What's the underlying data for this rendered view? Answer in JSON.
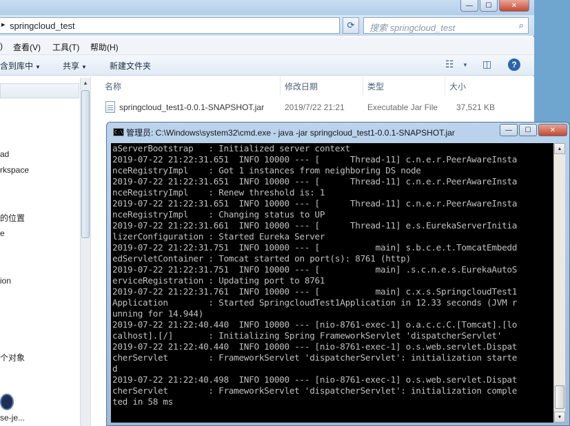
{
  "explorer": {
    "address": "springcloud_test",
    "search_placeholder": "搜索 springcloud_test",
    "menu": [
      "查看(V)",
      "工具(T)",
      "帮助(H)"
    ],
    "menu_partial": ")",
    "toolbar": {
      "include_library": "含到库中",
      "share": "共享",
      "new_folder": "新建文件夹"
    },
    "nav_items": [
      "ad",
      "rkspace",
      "的位置",
      "e",
      "ion",
      "个对象"
    ],
    "taskbar_label": "se-je...",
    "columns": {
      "name": "名称",
      "modified": "修改日期",
      "type": "类型",
      "size": "大小"
    },
    "files": [
      {
        "name": "springcloud_test1-0.0.1-SNAPSHOT.jar",
        "modified": "2019/7/22 21:21",
        "type": "Executable Jar File",
        "size": "37,521 KB"
      }
    ]
  },
  "cmd": {
    "title": "管理员: C:\\Windows\\system32\\cmd.exe - java  -jar springcloud_test1-0.0.1-SNAPSHOT.jar",
    "icon_text": "C:\\",
    "lines": [
      "aServerBootstrap   : Initialized server context",
      "2019-07-22 21:22:31.651  INFO 10000 --- [      Thread-11] c.n.e.r.PeerAwareInsta",
      "nceRegistryImpl    : Got 1 instances from neighboring DS node",
      "2019-07-22 21:22:31.651  INFO 10000 --- [      Thread-11] c.n.e.r.PeerAwareInsta",
      "nceRegistryImpl    : Renew threshold is: 1",
      "2019-07-22 21:22:31.651  INFO 10000 --- [      Thread-11] c.n.e.r.PeerAwareInsta",
      "nceRegistryImpl    : Changing status to UP",
      "2019-07-22 21:22:31.661  INFO 10000 --- [      Thread-11] e.s.EurekaServerInitia",
      "lizerConfiguration : Started Eureka Server",
      "2019-07-22 21:22:31.751  INFO 10000 --- [           main] s.b.c.e.t.TomcatEmbedd",
      "edServletContainer : Tomcat started on port(s): 8761 (http)",
      "2019-07-22 21:22:31.751  INFO 10000 --- [           main] .s.c.n.e.s.EurekaAutoS",
      "erviceRegistration : Updating port to 8761",
      "2019-07-22 21:22:31.761  INFO 10000 --- [           main] c.x.s.SpringcloudTest1",
      "Application        : Started SpringcloudTest1Application in 12.33 seconds (JVM r",
      "unning for 14.944)",
      "2019-07-22 21:22:40.440  INFO 10000 --- [nio-8761-exec-1] o.a.c.c.C.[Tomcat].[lo",
      "calhost].[/]       : Initializing Spring FrameworkServlet 'dispatcherServlet'",
      "2019-07-22 21:22:40.440  INFO 10000 --- [nio-8761-exec-1] o.s.web.servlet.Dispat",
      "cherServlet        : FrameworkServlet 'dispatcherServlet': initialization starte",
      "d",
      "2019-07-22 21:22:40.498  INFO 10000 --- [nio-8761-exec-1] o.s.web.servlet.Dispat",
      "cherServlet        : FrameworkServlet 'dispatcherServlet': initialization comple",
      "ted in 58 ms"
    ]
  }
}
